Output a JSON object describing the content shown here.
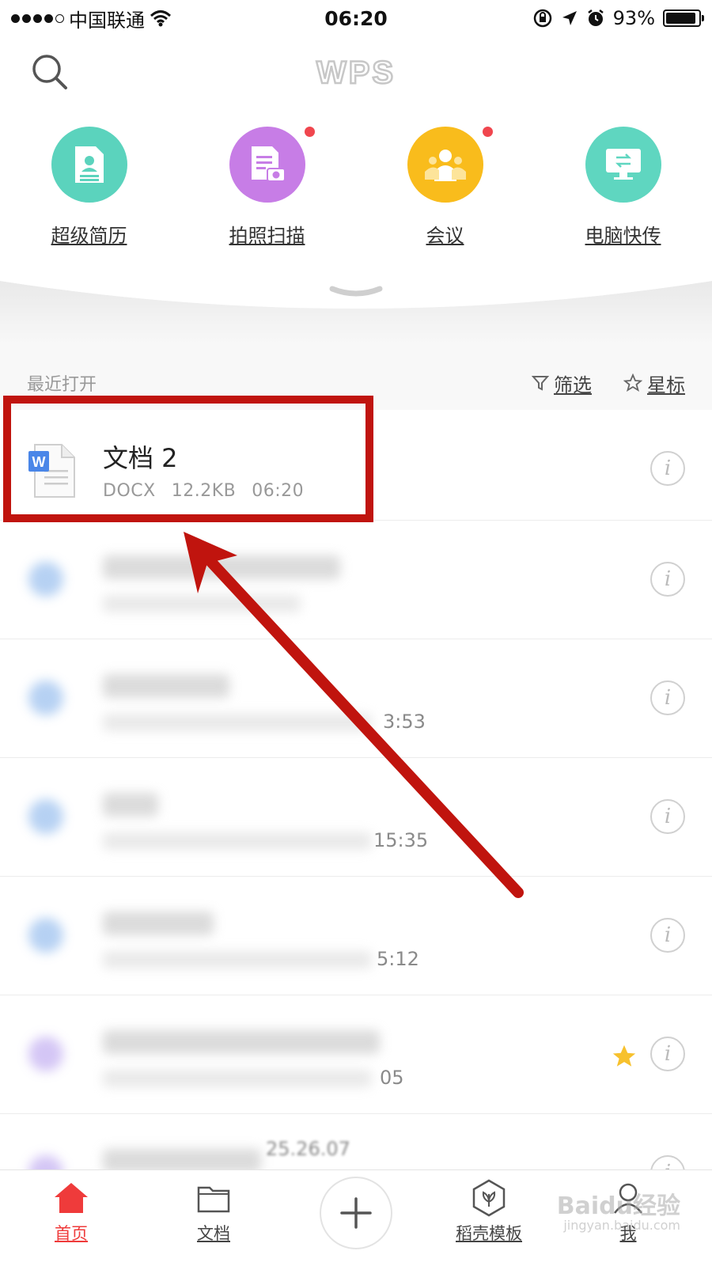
{
  "status_bar": {
    "carrier": "中国联通",
    "time": "06:20",
    "battery": "93%",
    "battery_level": 0.93
  },
  "header": {
    "logo": "WPS"
  },
  "shortcuts": [
    {
      "label": "超级简历",
      "icon": "resume-icon",
      "color": "#5bd3bd",
      "has_dot": false
    },
    {
      "label": "拍照扫描",
      "icon": "scan-icon",
      "color": "#c77de6",
      "has_dot": true
    },
    {
      "label": "会议",
      "icon": "meeting-icon",
      "color": "#f9bc1c",
      "has_dot": true
    },
    {
      "label": "电脑快传",
      "icon": "transfer-icon",
      "color": "#5fd6c0",
      "has_dot": false
    }
  ],
  "recent": {
    "title": "最近打开",
    "filter_label": "筛选",
    "star_label": "星标"
  },
  "files": [
    {
      "name": "文档 2",
      "type": "DOCX",
      "size": "12.2KB",
      "time": "06:20"
    },
    {
      "time_tail": ""
    },
    {
      "time_tail": "3:53"
    },
    {
      "time_tail": "15:35"
    },
    {
      "time_tail": "5:12"
    },
    {
      "time_tail": "05",
      "starred": true
    },
    {
      "time_tail": "25.26.07"
    }
  ],
  "tabs": {
    "home": "首页",
    "docs": "文档",
    "templates": "稻壳模板",
    "me": "我"
  },
  "watermark": {
    "brand": "Baidu经验",
    "url": "jingyan.baidu.com"
  },
  "colors": {
    "accent": "#ef3b3b",
    "highlight": "#c0140e"
  }
}
